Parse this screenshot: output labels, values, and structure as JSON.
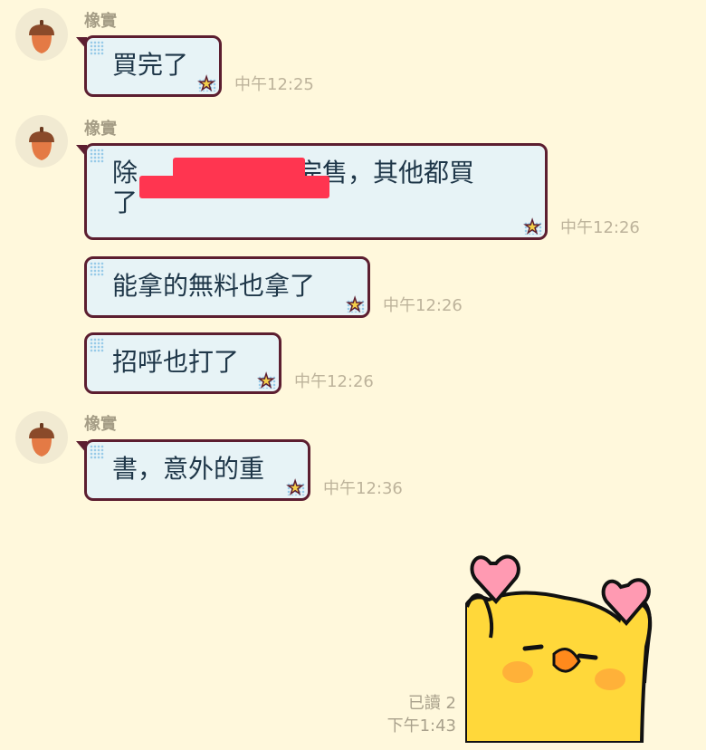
{
  "sender": "橡實",
  "messages": [
    {
      "text": "買完了",
      "time": "中午12:25"
    },
    {
      "text": "除[redacted]完售，其他都買了",
      "line1": "除",
      "line1b": "完售，其他都買",
      "line2": "了",
      "time": "中午12:26"
    },
    {
      "text": "能拿的無料也拿了",
      "time": "中午12:26"
    },
    {
      "text": "招呼也打了",
      "time": "中午12:26"
    },
    {
      "text": "書，意外的重",
      "time": "中午12:36"
    }
  ],
  "outgoing": {
    "read_label": "已讀 2",
    "time": "下午1:43",
    "sticker": "yellow-chick-holding-hearts-sticker"
  },
  "colors": {
    "background": "#fff8dc",
    "bubble_fill": "#e7f3f6",
    "bubble_border": "#5c1e30",
    "text": "#1e3648",
    "redaction": "#ff3550",
    "sticker_yellow": "#ffd83a",
    "heart_pink": "#ff9ab2"
  },
  "icons": [
    "acorn-avatar-icon",
    "star-icon"
  ]
}
